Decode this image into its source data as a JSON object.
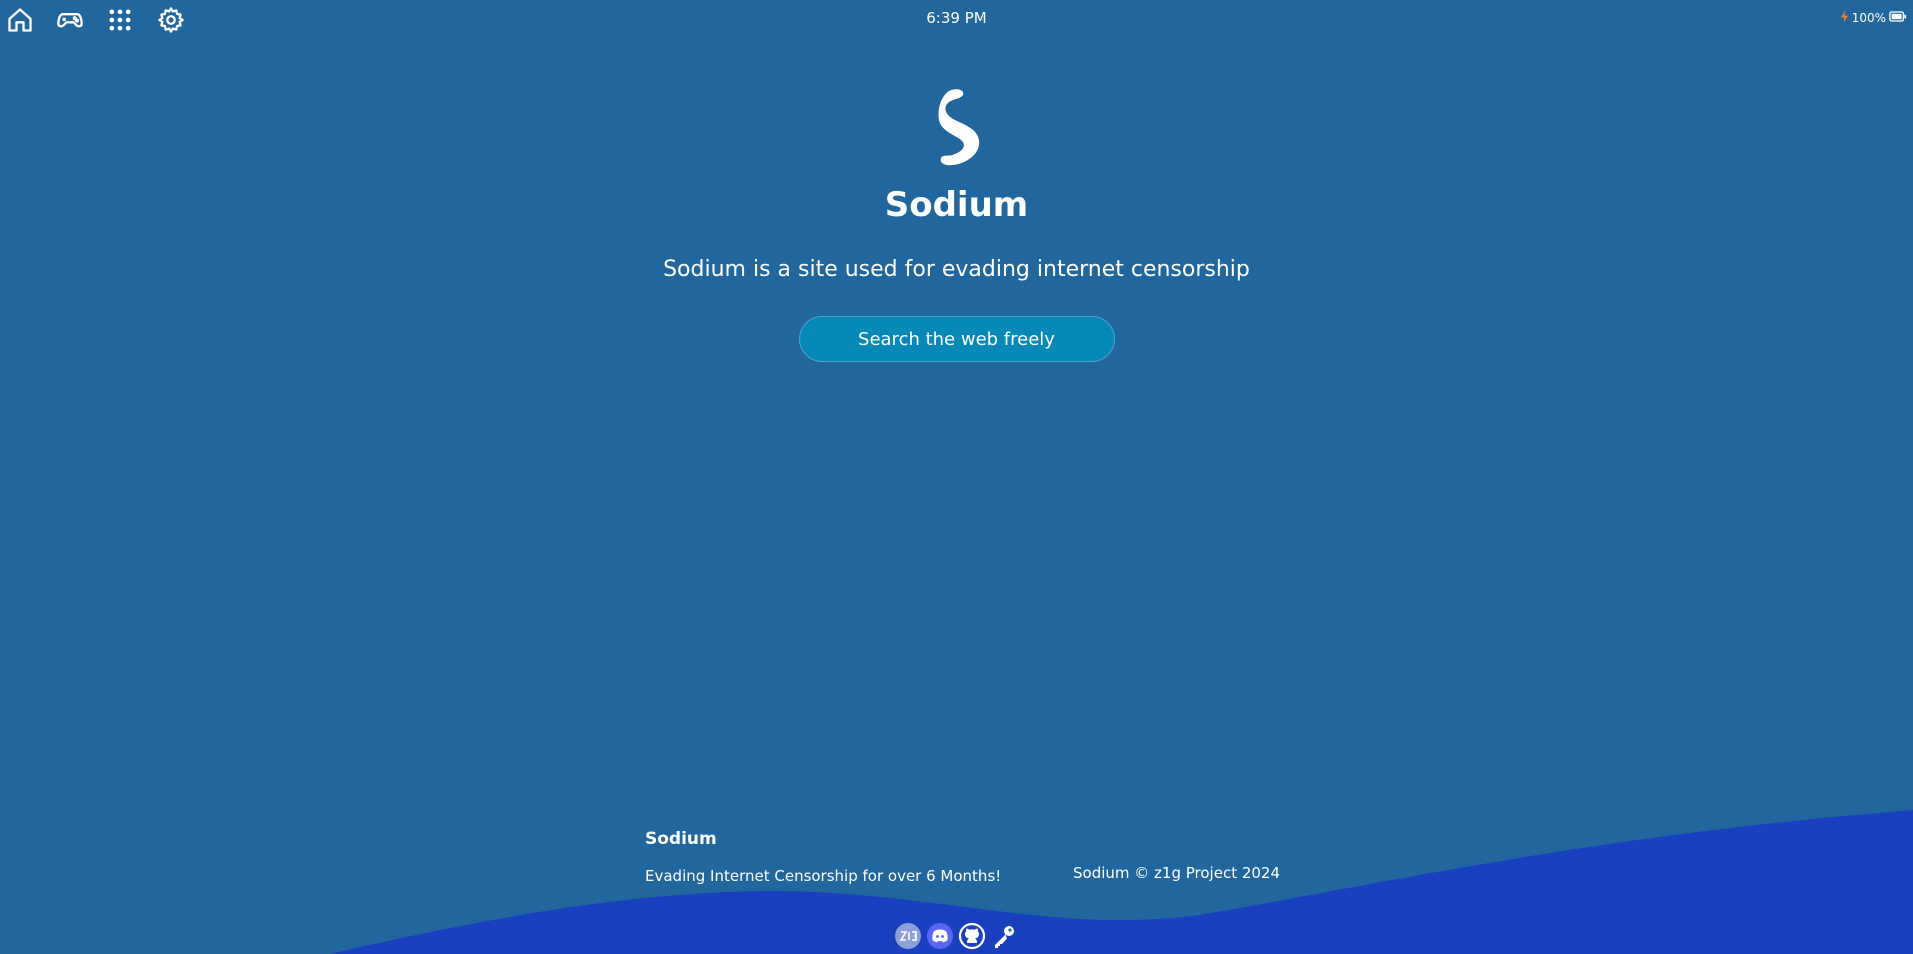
{
  "topbar": {
    "icons": [
      "home-icon",
      "gamepad-icon",
      "apps-grid-icon",
      "gear-icon"
    ],
    "clock": "6:39 PM",
    "battery": {
      "label": "100%",
      "level": 1.0
    }
  },
  "hero": {
    "title": "Sodium",
    "subtitle": "Sodium is a site used for evading internet censorship",
    "cta_label": "Search the web freely"
  },
  "footer": {
    "brand": "Sodium",
    "tagline": "Evading Internet Censorship for over 6 Months!",
    "copyright": "Sodium © z1g Project 2024",
    "links": [
      "z1g-icon",
      "discord-icon",
      "github-icon",
      "key-icon"
    ]
  },
  "colors": {
    "background": "#21669d",
    "accent_button": "#0689b7",
    "wave": "#1a40bf",
    "text": "#ffffff",
    "charging": "#ff7a2f"
  }
}
